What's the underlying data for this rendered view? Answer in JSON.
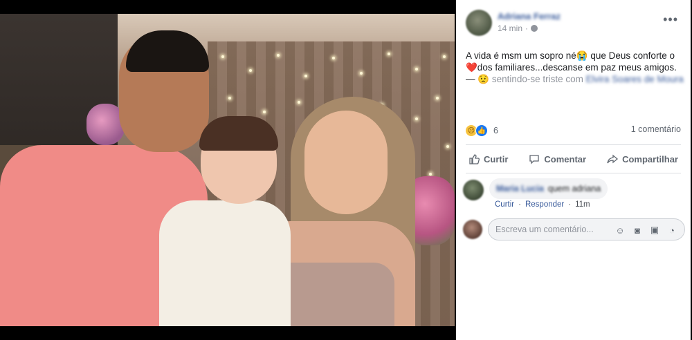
{
  "post": {
    "author_name": "Adriana Ferraz",
    "time_ago": "14 min",
    "text_main": "A vida é msm um sopro né😭 que Deus conforte o ❤️dos familiares...descanse em paz meus amigos. —",
    "feeling_text": "sentindo-se triste com",
    "tagged_name": "Elvira Soares de Moura",
    "reactions_count": "6",
    "comments_count": "1 comentário"
  },
  "actions": {
    "like": "Curtir",
    "comment": "Comentar",
    "share": "Compartilhar"
  },
  "comment": {
    "author": "Maria Lucia",
    "text": "quem adriana",
    "like": "Curtir",
    "reply": "Responder",
    "time": "11m"
  },
  "composer": {
    "placeholder": "Escreva um comentário..."
  },
  "colors": {
    "link": "#365899",
    "like_blue": "#1877f2",
    "sad_yellow": "#f7c33f"
  },
  "icons": [
    "more-icon",
    "globe-icon",
    "sad-reaction-icon",
    "like-reaction-icon",
    "thumbs-up-icon",
    "comment-icon",
    "share-icon",
    "emoji-icon",
    "camera-icon",
    "gif-icon",
    "sticker-icon"
  ]
}
